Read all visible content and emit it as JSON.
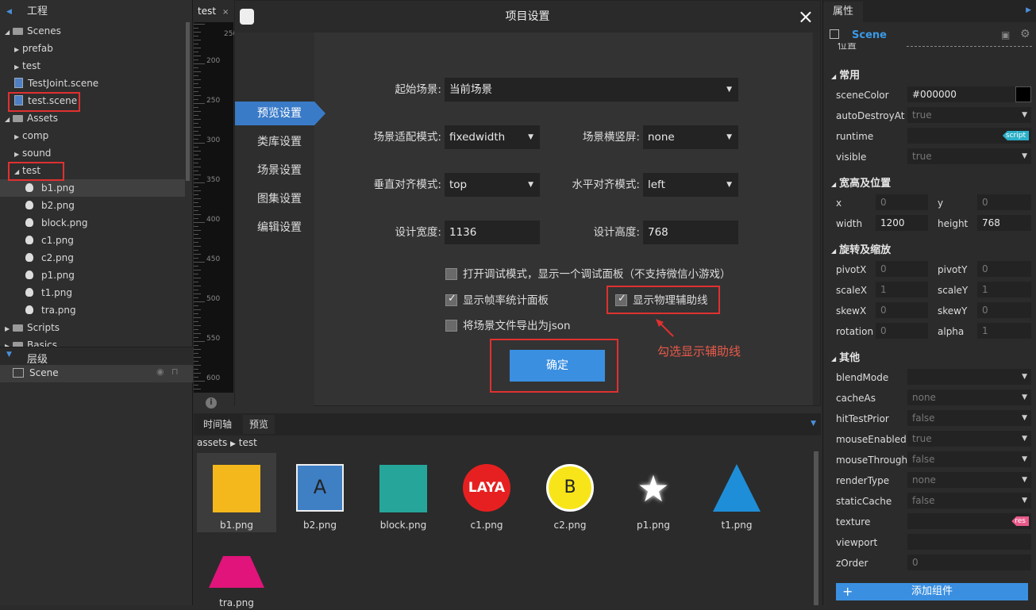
{
  "project_panel": {
    "title": "工程",
    "tree": [
      {
        "label": "Scenes",
        "indent": 0,
        "type": "folder",
        "expanded": true
      },
      {
        "label": "prefab",
        "indent": 1,
        "type": "folder-closed"
      },
      {
        "label": "test",
        "indent": 1,
        "type": "folder-closed"
      },
      {
        "label": "TestJoint.scene",
        "indent": 1,
        "type": "scene"
      },
      {
        "label": "test.scene",
        "indent": 1,
        "type": "scene"
      },
      {
        "label": "Assets",
        "indent": 0,
        "type": "folder",
        "expanded": true
      },
      {
        "label": "comp",
        "indent": 1,
        "type": "folder-closed"
      },
      {
        "label": "sound",
        "indent": 1,
        "type": "folder-closed"
      },
      {
        "label": "test",
        "indent": 1,
        "type": "folder-open"
      },
      {
        "label": "b1.png",
        "indent": 2,
        "type": "png"
      },
      {
        "label": "b2.png",
        "indent": 2,
        "type": "png"
      },
      {
        "label": "block.png",
        "indent": 2,
        "type": "png"
      },
      {
        "label": "c1.png",
        "indent": 2,
        "type": "png"
      },
      {
        "label": "c2.png",
        "indent": 2,
        "type": "png"
      },
      {
        "label": "p1.png",
        "indent": 2,
        "type": "png"
      },
      {
        "label": "t1.png",
        "indent": 2,
        "type": "png"
      },
      {
        "label": "tra.png",
        "indent": 2,
        "type": "png"
      },
      {
        "label": "Scripts",
        "indent": 0,
        "type": "folder-collapsed"
      },
      {
        "label": "Basics",
        "indent": 0,
        "type": "folder-collapsed"
      }
    ],
    "layer_title": "层级",
    "layer_item": "Scene"
  },
  "stage": {
    "tab": "test",
    "ruler_labels": [
      "250",
      "200",
      "250",
      "300",
      "350",
      "400",
      "450",
      "500",
      "550",
      "600"
    ]
  },
  "bottom": {
    "tabs": [
      "时间轴",
      "预览"
    ],
    "breadcrumb_root": "assets",
    "breadcrumb_leaf": "test",
    "assets": [
      {
        "name": "b1.png",
        "shape": "square",
        "color": "#f5b81c"
      },
      {
        "name": "b2.png",
        "shape": "box-a",
        "color": "#3f7fc4"
      },
      {
        "name": "block.png",
        "shape": "square",
        "color": "#26a69a"
      },
      {
        "name": "c1.png",
        "shape": "circle-laya",
        "color": "#e62020"
      },
      {
        "name": "c2.png",
        "shape": "circle-b",
        "color": "#f7e51a"
      },
      {
        "name": "p1.png",
        "shape": "star",
        "color": "#ffffff"
      },
      {
        "name": "t1.png",
        "shape": "triangle",
        "color": "#1e8ed8"
      },
      {
        "name": "tra.png",
        "shape": "trapezoid",
        "color": "#e0147a"
      }
    ],
    "c1_text": "LAYA",
    "c2_text": "B",
    "b2_text": "A"
  },
  "dialog": {
    "title": "项目设置",
    "nav": [
      "预览设置",
      "类库设置",
      "场景设置",
      "图集设置",
      "编辑设置"
    ],
    "fields": {
      "start_scene_label": "起始场景:",
      "start_scene": "当前场景",
      "adapt_label": "场景适配模式:",
      "adapt": "fixedwidth",
      "orient_label": "场景横竖屏:",
      "orient": "none",
      "valign_label": "垂直对齐模式:",
      "valign": "top",
      "halign_label": "水平对齐模式:",
      "halign": "left",
      "width_label": "设计宽度:",
      "width": "1136",
      "height_label": "设计高度:",
      "height": "768"
    },
    "checks": {
      "debug": "打开调试模式，显示一个调试面板（不支持微信小游戏）",
      "fps": "显示帧率统计面板",
      "physics": "显示物理辅助线",
      "json": "将场景文件导出为json"
    },
    "ok": "确定",
    "annotation": "勾选显示辅助线"
  },
  "properties": {
    "tab": "属性",
    "scene_name": "Scene",
    "partial_row": "位置",
    "sec_common": "常用",
    "sceneColor_label": "sceneColor",
    "sceneColor": "#000000",
    "autoDestroyAt_label": "autoDestroyAt",
    "autoDestroyAt": "true",
    "runtime_label": "runtime",
    "runtime_tag": "script",
    "visible_label": "visible",
    "visible": "true",
    "sec_size": "宽高及位置",
    "x_label": "x",
    "x": "0",
    "y_label": "y",
    "y": "0",
    "w_label": "width",
    "w": "1200",
    "h_label": "height",
    "h": "768",
    "sec_rot": "旋转及缩放",
    "pivotX_label": "pivotX",
    "pivotX": "0",
    "pivotY_label": "pivotY",
    "pivotY": "0",
    "scaleX_label": "scaleX",
    "scaleX": "1",
    "scaleY_label": "scaleY",
    "scaleY": "1",
    "skewX_label": "skewX",
    "skewX": "0",
    "skewY_label": "skewY",
    "skewY": "0",
    "rotation_label": "rotation",
    "rotation": "0",
    "alpha_label": "alpha",
    "alpha": "1",
    "sec_other": "其他",
    "blendMode_label": "blendMode",
    "cacheAs_label": "cacheAs",
    "cacheAs": "none",
    "hitTestPrior_label": "hitTestPrior",
    "hitTestPrior": "false",
    "mouseEnabled_label": "mouseEnabled",
    "mouseEnabled": "true",
    "mouseThrough_label": "mouseThrough",
    "mouseThrough": "false",
    "renderType_label": "renderType",
    "renderType": "none",
    "staticCache_label": "staticCache",
    "staticCache": "false",
    "texture_label": "texture",
    "texture_tag": "res",
    "viewport_label": "viewport",
    "zOrder_label": "zOrder",
    "zOrder": "0",
    "add_component": "添加组件"
  }
}
